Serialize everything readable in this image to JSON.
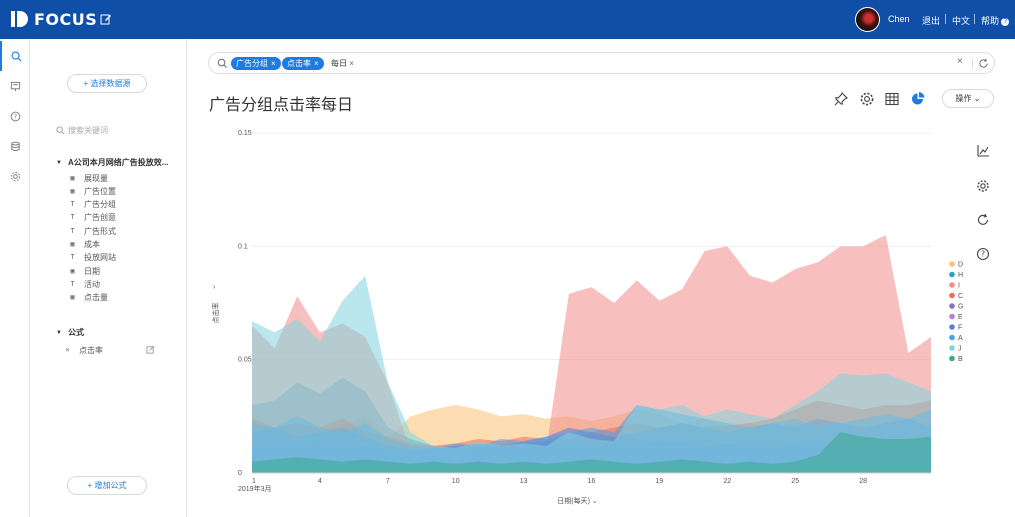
{
  "topbar": {
    "logo_text": "FOCUS",
    "user_name": "Chen",
    "links": {
      "logout": "退出",
      "language": "中文",
      "help": "帮助"
    }
  },
  "panel": {
    "select_source_label": "选择数据源",
    "search_placeholder": "搜索关键词",
    "table_name": "A公司本月网络广告投放效...",
    "fields": [
      {
        "label": "展现量",
        "icon": "measure-icon"
      },
      {
        "label": "广告位置",
        "icon": "measure-icon"
      },
      {
        "label": "广告分组",
        "icon": "attribute-icon"
      },
      {
        "label": "广告创意",
        "icon": "attribute-icon"
      },
      {
        "label": "广告形式",
        "icon": "attribute-icon"
      },
      {
        "label": "成本",
        "icon": "measure-icon"
      },
      {
        "label": "投放网站",
        "icon": "attribute-icon"
      },
      {
        "label": "日期",
        "icon": "calendar-icon"
      },
      {
        "label": "活动",
        "icon": "attribute-icon"
      },
      {
        "label": "点击量",
        "icon": "measure-icon"
      }
    ],
    "formula_group": "公式",
    "formula_item": "点击率",
    "add_formula_label": "增加公式"
  },
  "search": {
    "chips": [
      "广告分组",
      "点击率"
    ],
    "plain_token": "每日"
  },
  "page_title": "广告分组点击率每日",
  "operation_label": "操作",
  "colors": {
    "brand": "#0f4fa8",
    "accent": "#1e7be0"
  },
  "chart_data": {
    "type": "area",
    "xlabel": "日期(每天)",
    "ylabel": "点击率",
    "ylim": [
      0,
      0.15
    ],
    "yticks": [
      "0",
      "0.05",
      "0.1",
      "0.15"
    ],
    "x": [
      1,
      2,
      3,
      4,
      5,
      6,
      7,
      8,
      9,
      10,
      11,
      12,
      13,
      14,
      15,
      16,
      17,
      18,
      19,
      20,
      21,
      22,
      23,
      24,
      25,
      26,
      27,
      28,
      29,
      30,
      31
    ],
    "xticks": [
      "1",
      "4",
      "7",
      "10",
      "13",
      "16",
      "19",
      "22",
      "25",
      "28"
    ],
    "x_first_sublabel": "2019年3月",
    "series": [
      {
        "name": "D",
        "color": "#f9c173",
        "values": [
          0.02,
          0.018,
          0.02,
          0.016,
          0.02,
          0.025,
          0.015,
          0.025,
          0.028,
          0.03,
          0.028,
          0.025,
          0.026,
          0.024,
          0.025,
          0.023,
          0.025,
          0.028,
          0.026,
          0.022,
          0.024,
          0.021,
          0.022,
          0.02,
          0.022,
          0.024,
          0.021,
          0.02,
          0.022,
          0.02,
          0.023
        ]
      },
      {
        "name": "H",
        "color": "#29a0c7",
        "values": [
          0.03,
          0.032,
          0.04,
          0.035,
          0.042,
          0.036,
          0.02,
          0.015,
          0.012,
          0.01,
          0.012,
          0.011,
          0.013,
          0.014,
          0.015,
          0.014,
          0.016,
          0.015,
          0.013,
          0.014,
          0.012,
          0.013,
          0.012,
          0.014,
          0.013,
          0.015,
          0.014,
          0.013,
          0.015,
          0.014,
          0.012
        ]
      },
      {
        "name": "I",
        "color": "#f08d8b",
        "values": [
          0.065,
          0.055,
          0.078,
          0.062,
          0.066,
          0.06,
          0.04,
          0.01,
          0.008,
          0.009,
          0.012,
          0.01,
          0.011,
          0.01,
          0.079,
          0.082,
          0.075,
          0.085,
          0.076,
          0.081,
          0.098,
          0.1,
          0.087,
          0.084,
          0.09,
          0.093,
          0.1,
          0.1,
          0.105,
          0.053,
          0.06
        ]
      },
      {
        "name": "C",
        "color": "#ef6b5b",
        "values": [
          0.024,
          0.02,
          0.022,
          0.02,
          0.024,
          0.018,
          0.016,
          0.013,
          0.012,
          0.013,
          0.015,
          0.014,
          0.016,
          0.015,
          0.015,
          0.018,
          0.02,
          0.022,
          0.02,
          0.022,
          0.02,
          0.021,
          0.022,
          0.024,
          0.028,
          0.032,
          0.03,
          0.028,
          0.03,
          0.03,
          0.032
        ]
      },
      {
        "name": "G",
        "color": "#8b6fc2",
        "values": [
          0.01,
          0.012,
          0.014,
          0.011,
          0.013,
          0.012,
          0.01,
          0.009,
          0.01,
          0.011,
          0.01,
          0.012,
          0.011,
          0.013,
          0.012,
          0.011,
          0.013,
          0.012,
          0.014,
          0.012,
          0.011,
          0.013,
          0.012,
          0.011,
          0.013,
          0.012,
          0.011,
          0.012,
          0.013,
          0.011,
          0.012
        ]
      },
      {
        "name": "E",
        "color": "#b87fd6",
        "values": [
          0.012,
          0.014,
          0.013,
          0.015,
          0.012,
          0.011,
          0.01,
          0.011,
          0.012,
          0.01,
          0.011,
          0.012,
          0.01,
          0.011,
          0.013,
          0.012,
          0.011,
          0.013,
          0.012,
          0.014,
          0.012,
          0.011,
          0.013,
          0.012,
          0.011,
          0.013,
          0.012,
          0.014,
          0.012,
          0.013,
          0.011
        ]
      },
      {
        "name": "F",
        "color": "#5a7fd6",
        "values": [
          0.018,
          0.02,
          0.016,
          0.018,
          0.02,
          0.016,
          0.012,
          0.01,
          0.011,
          0.012,
          0.013,
          0.012,
          0.014,
          0.016,
          0.02,
          0.018,
          0.016,
          0.018,
          0.02,
          0.022,
          0.02,
          0.018,
          0.02,
          0.022,
          0.02,
          0.024,
          0.022,
          0.02,
          0.022,
          0.024,
          0.02
        ]
      },
      {
        "name": "A",
        "color": "#4aa3e8",
        "values": [
          0.022,
          0.02,
          0.025,
          0.02,
          0.018,
          0.022,
          0.015,
          0.012,
          0.011,
          0.013,
          0.012,
          0.015,
          0.014,
          0.016,
          0.018,
          0.02,
          0.018,
          0.03,
          0.028,
          0.026,
          0.024,
          0.022,
          0.02,
          0.022,
          0.024,
          0.02,
          0.022,
          0.024,
          0.026,
          0.024,
          0.028
        ]
      },
      {
        "name": "J",
        "color": "#7fd4de",
        "values": [
          0.067,
          0.062,
          0.068,
          0.058,
          0.076,
          0.087,
          0.04,
          0.018,
          0.012,
          0.011,
          0.014,
          0.012,
          0.013,
          0.012,
          0.018,
          0.015,
          0.014,
          0.03,
          0.028,
          0.03,
          0.025,
          0.028,
          0.026,
          0.024,
          0.03,
          0.036,
          0.044,
          0.043,
          0.044,
          0.04,
          0.036
        ]
      },
      {
        "name": "B",
        "color": "#3aaa8f",
        "values": [
          0.005,
          0.006,
          0.007,
          0.006,
          0.005,
          0.006,
          0.005,
          0.004,
          0.005,
          0.004,
          0.005,
          0.004,
          0.005,
          0.004,
          0.005,
          0.006,
          0.005,
          0.004,
          0.005,
          0.006,
          0.005,
          0.004,
          0.005,
          0.004,
          0.005,
          0.008,
          0.018,
          0.016,
          0.015,
          0.015,
          0.016
        ]
      }
    ]
  }
}
